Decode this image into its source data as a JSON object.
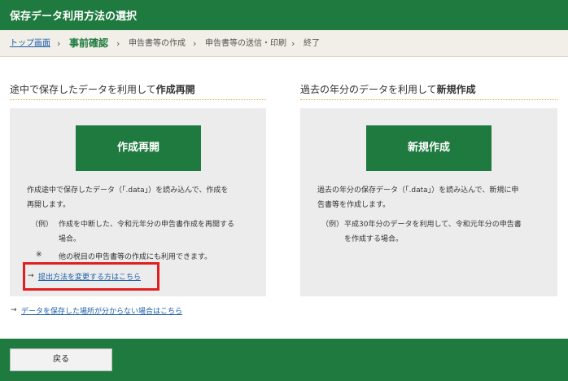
{
  "header": {
    "title": "保存データ利用方法の選択"
  },
  "breadcrumb": {
    "top_link": "トップ画面",
    "current": "事前確認",
    "step3": "申告書等の作成",
    "step4": "申告書等の送信・印刷",
    "step5": "終了",
    "separator": "›"
  },
  "left": {
    "title_prefix": "途中で保存したデータを利用して",
    "title_bold": "作成再開",
    "button_label": "作成再開",
    "desc_line1": "作成途中で保存したデータ（「.data」）を読み込んで、作成を",
    "desc_line2": "再開します。",
    "example_tag": "（例）",
    "example_line1": "作成を中断した、令和元年分の申告書作成を再開する",
    "example_line2": "場合。",
    "note_tag": "※",
    "note_text": "他の税目の申告書等の作成にも利用できます。",
    "change_link": "提出方法を変更する方はこちら",
    "arrow": "→"
  },
  "right": {
    "title_prefix": "過去の年分のデータを利用して",
    "title_bold": "新規作成",
    "button_label": "新規作成",
    "desc_line1": "過去の年分の保存データ（「.data」）を読み込んで、新規に申",
    "desc_line2": "告書等を作成します。",
    "example_tag": "（例）",
    "example_line1": "平成30年分のデータを利用して、令和元年分の申告書",
    "example_line2": "を作成する場合。"
  },
  "bottom_link": {
    "arrow": "→",
    "text": "データを保存した場所が分からない場合はこちら"
  },
  "footer": {
    "back_label": "戻る"
  },
  "colors": {
    "brand_green": "#1e7a3e",
    "link_blue": "#1a5ea8",
    "highlight_red": "#e02020",
    "panel_gray": "#ececec"
  }
}
